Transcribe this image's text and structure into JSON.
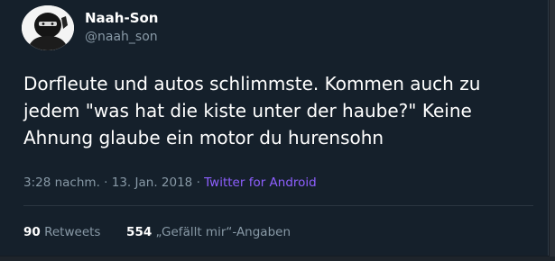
{
  "user": {
    "display_name": "Naah-Son",
    "handle": "@naah_son",
    "avatar_icon": "masked-face-avatar"
  },
  "tweet": {
    "lines": [
      "Dorfleute und autos schlimmste. Kommen auch zu",
      "jedem \"was hat die kiste unter der haube?\" Keine",
      "Ahnung glaube ein motor du hurensohn"
    ],
    "time": "3:28 nachm.",
    "sep1": "·",
    "date": "13. Jan. 2018",
    "sep2": "·",
    "source": "Twitter for Android"
  },
  "stats": {
    "retweets_count": "90",
    "retweets_label": "Retweets",
    "likes_count": "554",
    "likes_label": "„Gefällt mir“-Angaben"
  },
  "colors": {
    "background": "#15202b",
    "text": "#ffffff",
    "secondary": "#8899a6",
    "source_link": "#8e5fff"
  }
}
